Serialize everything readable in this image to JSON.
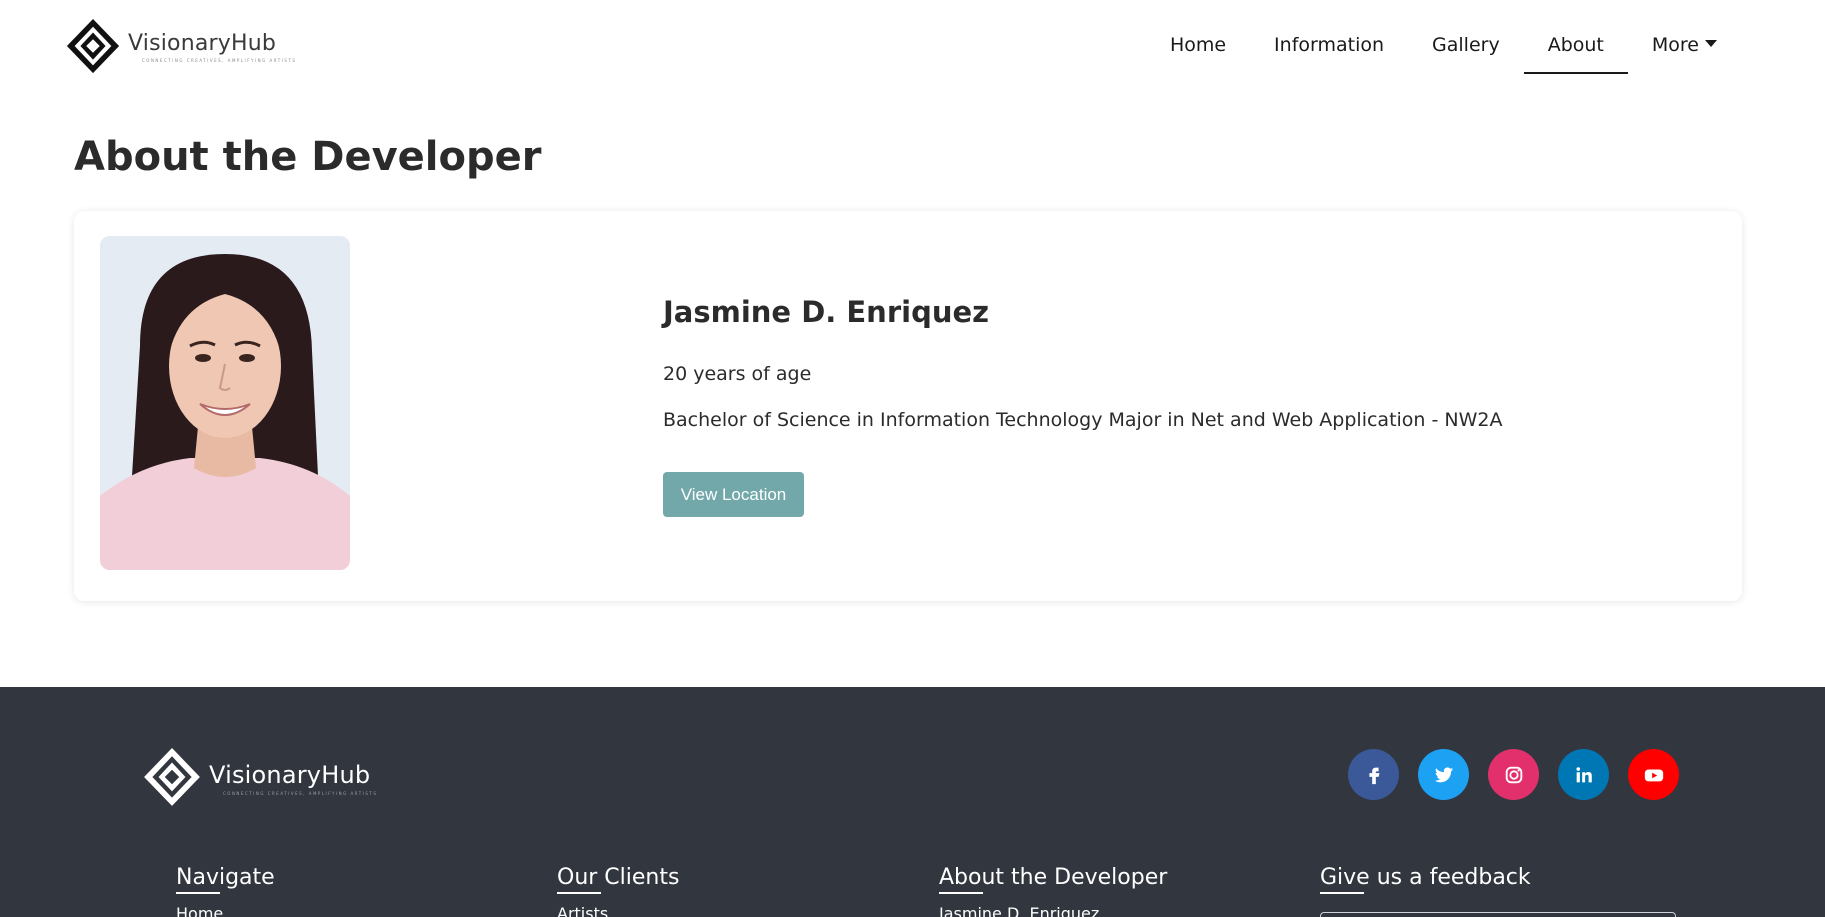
{
  "header": {
    "logo_text": "VisionaryHub",
    "logo_tagline": "CONNECTING CREATIVES, AMPLIFYING ARTISTS",
    "nav": [
      {
        "label": "Home"
      },
      {
        "label": "Information"
      },
      {
        "label": "Gallery"
      },
      {
        "label": "About"
      },
      {
        "label": "More"
      }
    ],
    "active_nav": "About"
  },
  "main": {
    "title": "About the Developer",
    "developer": {
      "name": "Jasmine D. Enriquez",
      "age": "20 years of age",
      "course": "Bachelor of Science in Information Technology Major in Net and Web Application - NW2A",
      "button_label": "View Location"
    }
  },
  "footer": {
    "logo_text": "VisionaryHub",
    "logo_tagline": "CONNECTING CREATIVES, AMPLIFYING ARTISTS",
    "socials": [
      {
        "name": "facebook-icon",
        "color": "#3b5998"
      },
      {
        "name": "twitter-icon",
        "color": "#1da1f2"
      },
      {
        "name": "instagram-icon",
        "color": "#e1306c"
      },
      {
        "name": "linkedin-icon",
        "color": "#0077b5"
      },
      {
        "name": "youtube-icon",
        "color": "#ff0000"
      }
    ],
    "columns": [
      {
        "heading": "Navigate",
        "first_link": "Home"
      },
      {
        "heading": "Our Clients",
        "first_link": "Artists"
      },
      {
        "heading": "About the Developer",
        "first_link": "Jasmine D. Enriquez"
      },
      {
        "heading": "Give us a feedback"
      }
    ]
  },
  "colors": {
    "accent_button": "#72a8aa",
    "footer_bg": "#31363f"
  }
}
